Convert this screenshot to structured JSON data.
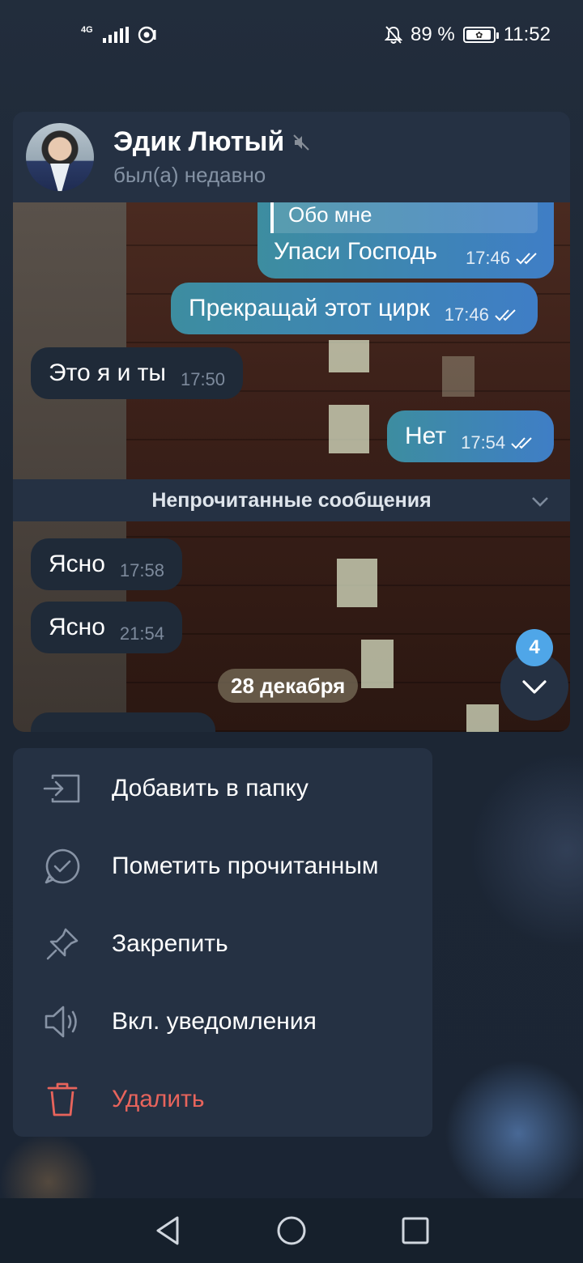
{
  "status_bar": {
    "network": "4G",
    "battery_percent": "89 %",
    "time": "11:52"
  },
  "chat": {
    "name": "Эдик Лютый",
    "status": "был(а) недавно",
    "muted": true,
    "reply_quote": "Обо мне",
    "messages": [
      {
        "direction": "out",
        "text": "Упаси Господь",
        "time": "17:46",
        "read": true
      },
      {
        "direction": "out",
        "text": "Прекращай этот цирк",
        "time": "17:46",
        "read": true
      },
      {
        "direction": "in",
        "text": "Это я и ты",
        "time": "17:50"
      },
      {
        "direction": "out",
        "text": "Нет",
        "time": "17:54",
        "read": true
      },
      {
        "direction": "in",
        "text": "Ясно",
        "time": "17:58"
      },
      {
        "direction": "in",
        "text": "Ясно",
        "time": "21:54"
      }
    ],
    "unread_divider": "Непрочитанные сообщения",
    "date_chip": "28 декабря",
    "unread_badge": "4"
  },
  "menu": {
    "items": [
      {
        "label": "Добавить в папку",
        "icon": "add-to-folder-icon"
      },
      {
        "label": "Пометить прочитанным",
        "icon": "mark-read-icon"
      },
      {
        "label": "Закрепить",
        "icon": "pin-icon"
      },
      {
        "label": "Вкл. уведомления",
        "icon": "speaker-icon"
      },
      {
        "label": "Удалить",
        "icon": "trash-icon"
      }
    ]
  },
  "colors": {
    "accent": "#4fa6e8",
    "danger": "#e8645c",
    "surface": "#253143"
  }
}
